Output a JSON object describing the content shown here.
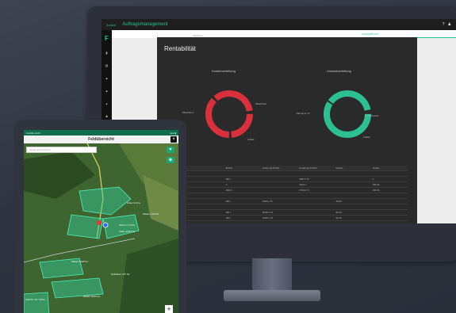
{
  "monitor": {
    "back_label": "Zurück",
    "app_title": "Auftragsmanagement",
    "help_icon": "?",
    "user_icon": "♟",
    "sidebar_logo": "F",
    "sidebar_icons": [
      "menu-icon",
      "document-icon",
      "tractor-icon",
      "tractor-icon",
      "chart-icon",
      "user-icon",
      "tool-icon",
      "settings-icon"
    ],
    "tabs": [
      "DETAILS",
      "AUSWERTUNG"
    ],
    "section_title": "Rentabilität",
    "chart_left": {
      "title": "Kostenverteilung",
      "labels": [
        "Maschinen",
        "Mitarbeiter",
        "Artikel"
      ]
    },
    "chart_right": {
      "title": "Umsatzverteilung",
      "labels": [
        "Menge in m³",
        "Umsatzposte",
        "Artikel"
      ]
    },
    "table": {
      "headers": [
        "",
        "Einheit",
        "Kosten (gr.STUnit)",
        "Umsatz (gr.STUnit)",
        "Gewinn",
        "Umsatz"
      ],
      "rows": [
        [
          "gesamt",
          "",
          "",
          "",
          "",
          ""
        ],
        [
          "Auftragsmenge m³",
          "180 t",
          "",
          "2503 m 75",
          "",
          "0"
        ],
        [
          "Maschinen",
          "1",
          "",
          "150.8 m",
          "",
          "150.8 €"
        ],
        [
          "",
          "1500 h",
          "",
          "2.513 € 73",
          "",
          "150.8 €"
        ],
        [
          "",
          "",
          "",
          "",
          "",
          ""
        ],
        [
          "Artikel",
          "180 t",
          "2503 m 75",
          "",
          "46.8 €",
          ""
        ],
        [
          "",
          "",
          "",
          "",
          "",
          ""
        ],
        [
          "Mitarbeiter Stunden",
          "180 t",
          "96.98 m 74",
          "",
          "96.4 €",
          ""
        ],
        [
          "Diesel",
          "180 t",
          "29.89 m 75",
          "",
          "92.3 €",
          ""
        ],
        [
          "",
          "",
          "",
          "",
          "",
          ""
        ],
        [
          "Summe",
          "84 t",
          "178 € 12",
          "122 m 21",
          "67.93 €",
          "98.2 €"
        ]
      ]
    }
  },
  "tablet": {
    "status_left": "Feldübersicht",
    "status_right": "●●● ▮",
    "title": "Feldübersicht",
    "close": "×",
    "search_placeholder": "Felder durchsuchen",
    "field_labels": [
      "Wiese 1 2,6 ha",
      "Acker 3,0 ha",
      "Wiese 1 0,9 ha",
      "Acker 14,87 ha",
      "Wiese 18,02 ha",
      "Hofwiese 1,67 ha",
      "Weide 18,02 ha"
    ],
    "field_number": "Feld Nr. 12 / 18 ha",
    "zoom_in": "+"
  },
  "colors": {
    "accent": "#25c48f",
    "cost_ring": "#d8313d",
    "revenue_ring": "#2bbf93"
  }
}
